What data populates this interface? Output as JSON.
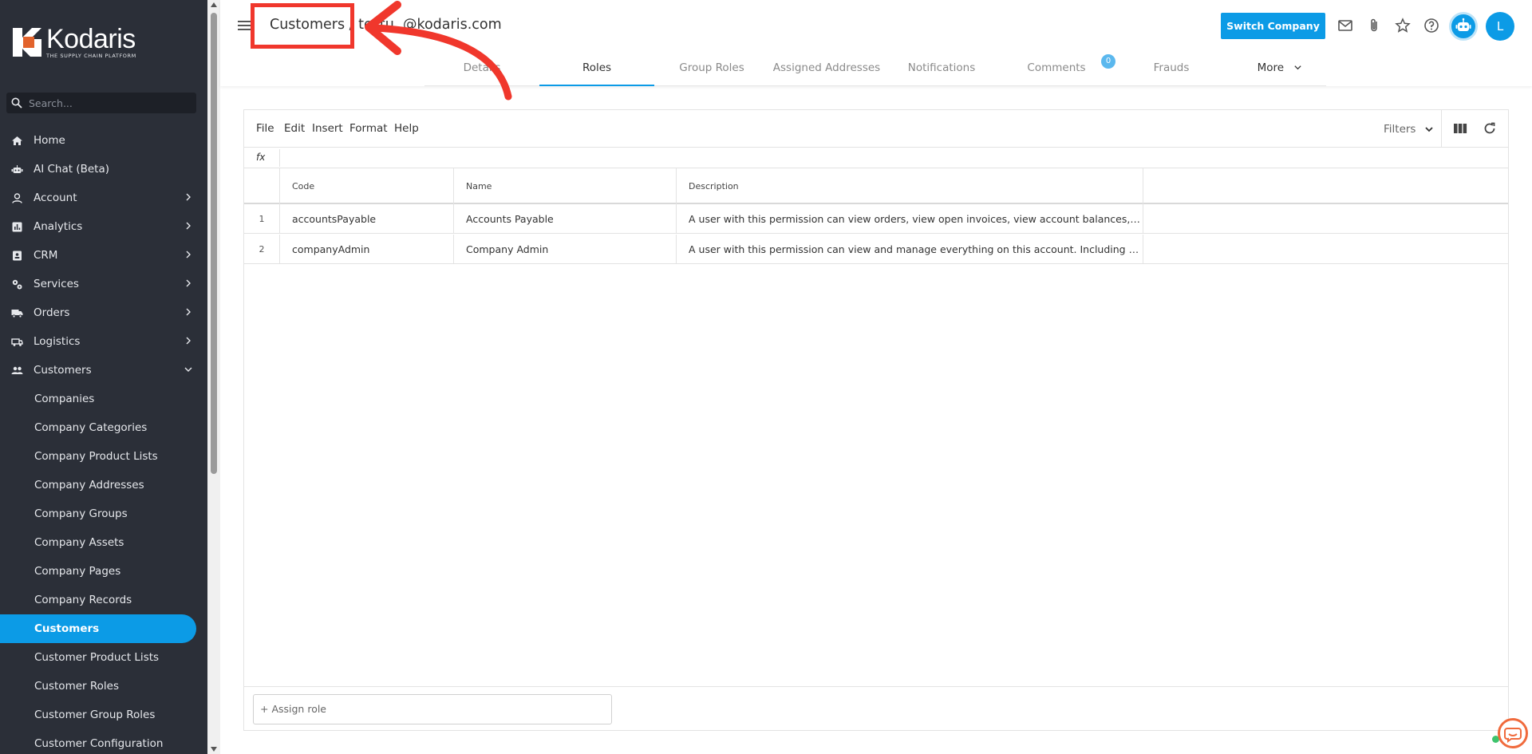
{
  "brand": {
    "name": "Kodaris",
    "tagline": "THE SUPPLY CHAIN PLATFORM",
    "accent_color": "#0c9be6"
  },
  "sidebar": {
    "search_placeholder": "Search...",
    "items": [
      {
        "label": "Home",
        "icon": "home-icon",
        "expandable": false
      },
      {
        "label": "AI Chat (Beta)",
        "icon": "robot-icon",
        "expandable": false
      },
      {
        "label": "Account",
        "icon": "user-icon",
        "expandable": true
      },
      {
        "label": "Analytics",
        "icon": "chart-icon",
        "expandable": true
      },
      {
        "label": "CRM",
        "icon": "contact-card-icon",
        "expandable": true
      },
      {
        "label": "Services",
        "icon": "gears-icon",
        "expandable": true
      },
      {
        "label": "Orders",
        "icon": "truck-icon",
        "expandable": true
      },
      {
        "label": "Logistics",
        "icon": "shipping-icon",
        "expandable": true
      },
      {
        "label": "Customers",
        "icon": "people-icon",
        "expandable": true,
        "expanded": true
      }
    ],
    "sub_items": [
      {
        "label": "Companies"
      },
      {
        "label": "Company Categories"
      },
      {
        "label": "Company Product Lists"
      },
      {
        "label": "Company Addresses"
      },
      {
        "label": "Company Groups"
      },
      {
        "label": "Company Assets"
      },
      {
        "label": "Company Pages"
      },
      {
        "label": "Company Records"
      },
      {
        "label": "Customers",
        "active": true
      },
      {
        "label": "Customer Product Lists"
      },
      {
        "label": "Customer Roles"
      },
      {
        "label": "Customer Group Roles"
      },
      {
        "label": "Customer Configuration"
      }
    ]
  },
  "header": {
    "breadcrumb": "Customers / testu..@kodaris.com",
    "switch_company_label": "Switch Company",
    "avatar_initial": "L",
    "icons": [
      "mail-icon",
      "paperclip-icon",
      "star-icon",
      "help-icon",
      "bot-icon"
    ]
  },
  "tabs": [
    {
      "label": "Details",
      "active": false
    },
    {
      "label": "Roles",
      "active": true
    },
    {
      "label": "Group Roles",
      "active": false
    },
    {
      "label": "Assigned Addresses",
      "active": false
    },
    {
      "label": "Notifications",
      "active": false
    },
    {
      "label": "Comments",
      "active": false,
      "badge": "0"
    },
    {
      "label": "Frauds",
      "active": false
    },
    {
      "label": "More",
      "active": false
    }
  ],
  "grid": {
    "menus": [
      "File",
      "Edit",
      "Insert",
      "Format",
      "Help"
    ],
    "filters_label": "Filters",
    "fx_label": "fx",
    "columns": [
      "Code",
      "Name",
      "Description"
    ],
    "rows": [
      {
        "num": "1",
        "code": "accountsPayable",
        "name": "Accounts Payable",
        "description": "A user with this permission can view orders, view open invoices, view account balances, and m..."
      },
      {
        "num": "2",
        "code": "companyAdmin",
        "name": "Company Admin",
        "description": "A user with this permission can view and manage everything on this account. Including but not ..."
      }
    ],
    "assign_label": "+ Assign role"
  },
  "annotation": {
    "color": "#f0372c"
  }
}
